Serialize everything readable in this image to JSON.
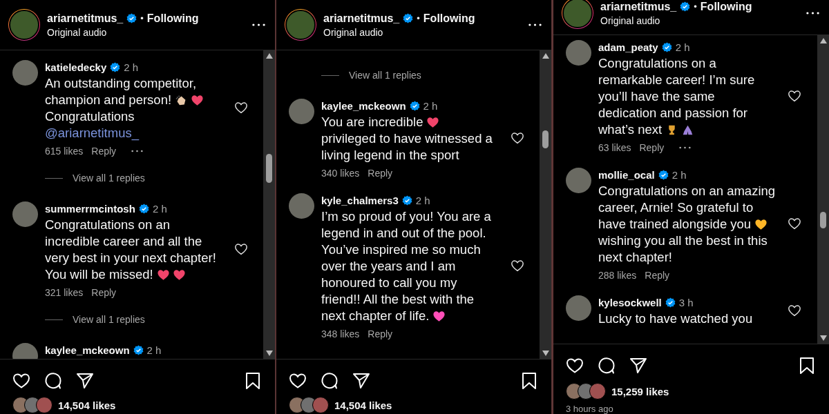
{
  "panels": [
    {
      "header": {
        "username": "ariarnetitmus_",
        "verified": true,
        "separator": "•",
        "follow": "Following",
        "audio": "Original audio"
      },
      "items": [
        {
          "kind": "comment",
          "username": "katieledecky",
          "verified": true,
          "time": "2 h",
          "lines": [
            [
              {
                "kind": "text",
                "text": "An outstanding competitor,"
              }
            ],
            [
              {
                "kind": "text",
                "text": "champion and person!"
              },
              {
                "kind": "clap"
              },
              {
                "kind": "heart",
                "color": "#f0446a"
              }
            ],
            [
              {
                "kind": "text",
                "text": "Congratulations"
              }
            ],
            [
              {
                "kind": "mention",
                "text": "@ariarnetitmus_"
              }
            ]
          ],
          "likes": "615 likes",
          "reply": "Reply",
          "more": true
        },
        {
          "kind": "replies",
          "text": "View all 1 replies"
        },
        {
          "kind": "comment",
          "username": "summerrmcintosh",
          "verified": true,
          "time": "2 h",
          "lines": [
            [
              {
                "kind": "text",
                "text": "Congratulations on an"
              }
            ],
            [
              {
                "kind": "text",
                "text": "incredible career and all the"
              }
            ],
            [
              {
                "kind": "text",
                "text": "very best in your next chapter!"
              }
            ],
            [
              {
                "kind": "text",
                "text": "You will be missed!"
              },
              {
                "kind": "heart",
                "color": "#f0446a"
              },
              {
                "kind": "heart",
                "color": "#f0446a"
              }
            ]
          ],
          "likes": "321 likes",
          "reply": "Reply",
          "more": false
        },
        {
          "kind": "replies",
          "text": "View all 1 replies"
        },
        {
          "kind": "comment",
          "username": "kaylee_mckeown",
          "verified": true,
          "time": "2 h",
          "more": false
        }
      ],
      "footer": {
        "likes": "14,504 likes"
      }
    },
    {
      "header": {
        "username": "ariarnetitmus_",
        "verified": true,
        "separator": "•",
        "follow": "Following",
        "audio": "Original audio"
      },
      "items": [
        {
          "kind": "replies",
          "text": "View all 1 replies"
        },
        {
          "kind": "comment",
          "username": "kaylee_mckeown",
          "verified": true,
          "time": "2 h",
          "lines": [
            [
              {
                "kind": "text",
                "text": "You are incredible"
              },
              {
                "kind": "heart",
                "color": "#f0446a"
              }
            ],
            [
              {
                "kind": "text",
                "text": "privileged to have witnessed a"
              }
            ],
            [
              {
                "kind": "text",
                "text": "living legend in the sport"
              }
            ]
          ],
          "likes": "340 likes",
          "reply": "Reply",
          "more": false
        },
        {
          "kind": "comment",
          "username": "kyle_chalmers3",
          "verified": true,
          "time": "2 h",
          "lines": [
            [
              {
                "kind": "text",
                "text": "I’m so proud of you! You are a"
              }
            ],
            [
              {
                "kind": "text",
                "text": "legend in and out of the pool."
              }
            ],
            [
              {
                "kind": "text",
                "text": "You’ve inspired me so much"
              }
            ],
            [
              {
                "kind": "text",
                "text": "over the years and I am"
              }
            ],
            [
              {
                "kind": "text",
                "text": "honoured to call you my"
              }
            ],
            [
              {
                "kind": "text",
                "text": "friend!! All the best with the"
              }
            ],
            [
              {
                "kind": "text",
                "text": "next chapter of life."
              },
              {
                "kind": "heart",
                "color": "#ff4fb8"
              }
            ]
          ],
          "likes": "348 likes",
          "reply": "Reply",
          "more": false
        }
      ],
      "footer": {
        "likes": "14,504 likes"
      }
    },
    {
      "header": {
        "username": "ariarnetitmus_",
        "verified": true,
        "separator": "•",
        "follow": "Following",
        "audio": "Original audio"
      },
      "items": [
        {
          "kind": "comment",
          "username": "adam_peaty",
          "verified": true,
          "time": "2 h",
          "lines": [
            [
              {
                "kind": "text",
                "text": "Congratulations on a"
              }
            ],
            [
              {
                "kind": "text",
                "text": "remarkable career! I’m sure"
              }
            ],
            [
              {
                "kind": "text",
                "text": "you’ll have the same"
              }
            ],
            [
              {
                "kind": "text",
                "text": "dedication and passion for"
              }
            ],
            [
              {
                "kind": "text",
                "text": "what’s next"
              },
              {
                "kind": "trophy"
              },
              {
                "kind": "pray"
              }
            ]
          ],
          "likes": "63 likes",
          "reply": "Reply",
          "more": true
        },
        {
          "kind": "comment",
          "username": "mollie_ocal",
          "verified": true,
          "time": "2 h",
          "lines": [
            [
              {
                "kind": "text",
                "text": "Congratulations on an amazing"
              }
            ],
            [
              {
                "kind": "text",
                "text": "career, Arnie! So grateful to"
              }
            ],
            [
              {
                "kind": "text",
                "text": "have trained alongside you"
              },
              {
                "kind": "heart",
                "color": "#ffb627"
              }
            ],
            [
              {
                "kind": "text",
                "text": "wishing you all the best in this"
              }
            ],
            [
              {
                "kind": "text",
                "text": "next chapter!"
              }
            ]
          ],
          "likes": "288 likes",
          "reply": "Reply",
          "more": false
        },
        {
          "kind": "comment",
          "username": "kylesockwell",
          "verified": true,
          "time": "3 h",
          "lines": [
            [
              {
                "kind": "text",
                "text": "Lucky to have watched you"
              }
            ]
          ],
          "more": false
        }
      ],
      "footer": {
        "likes": "15,259 likes",
        "time": "3 hours ago"
      }
    }
  ]
}
